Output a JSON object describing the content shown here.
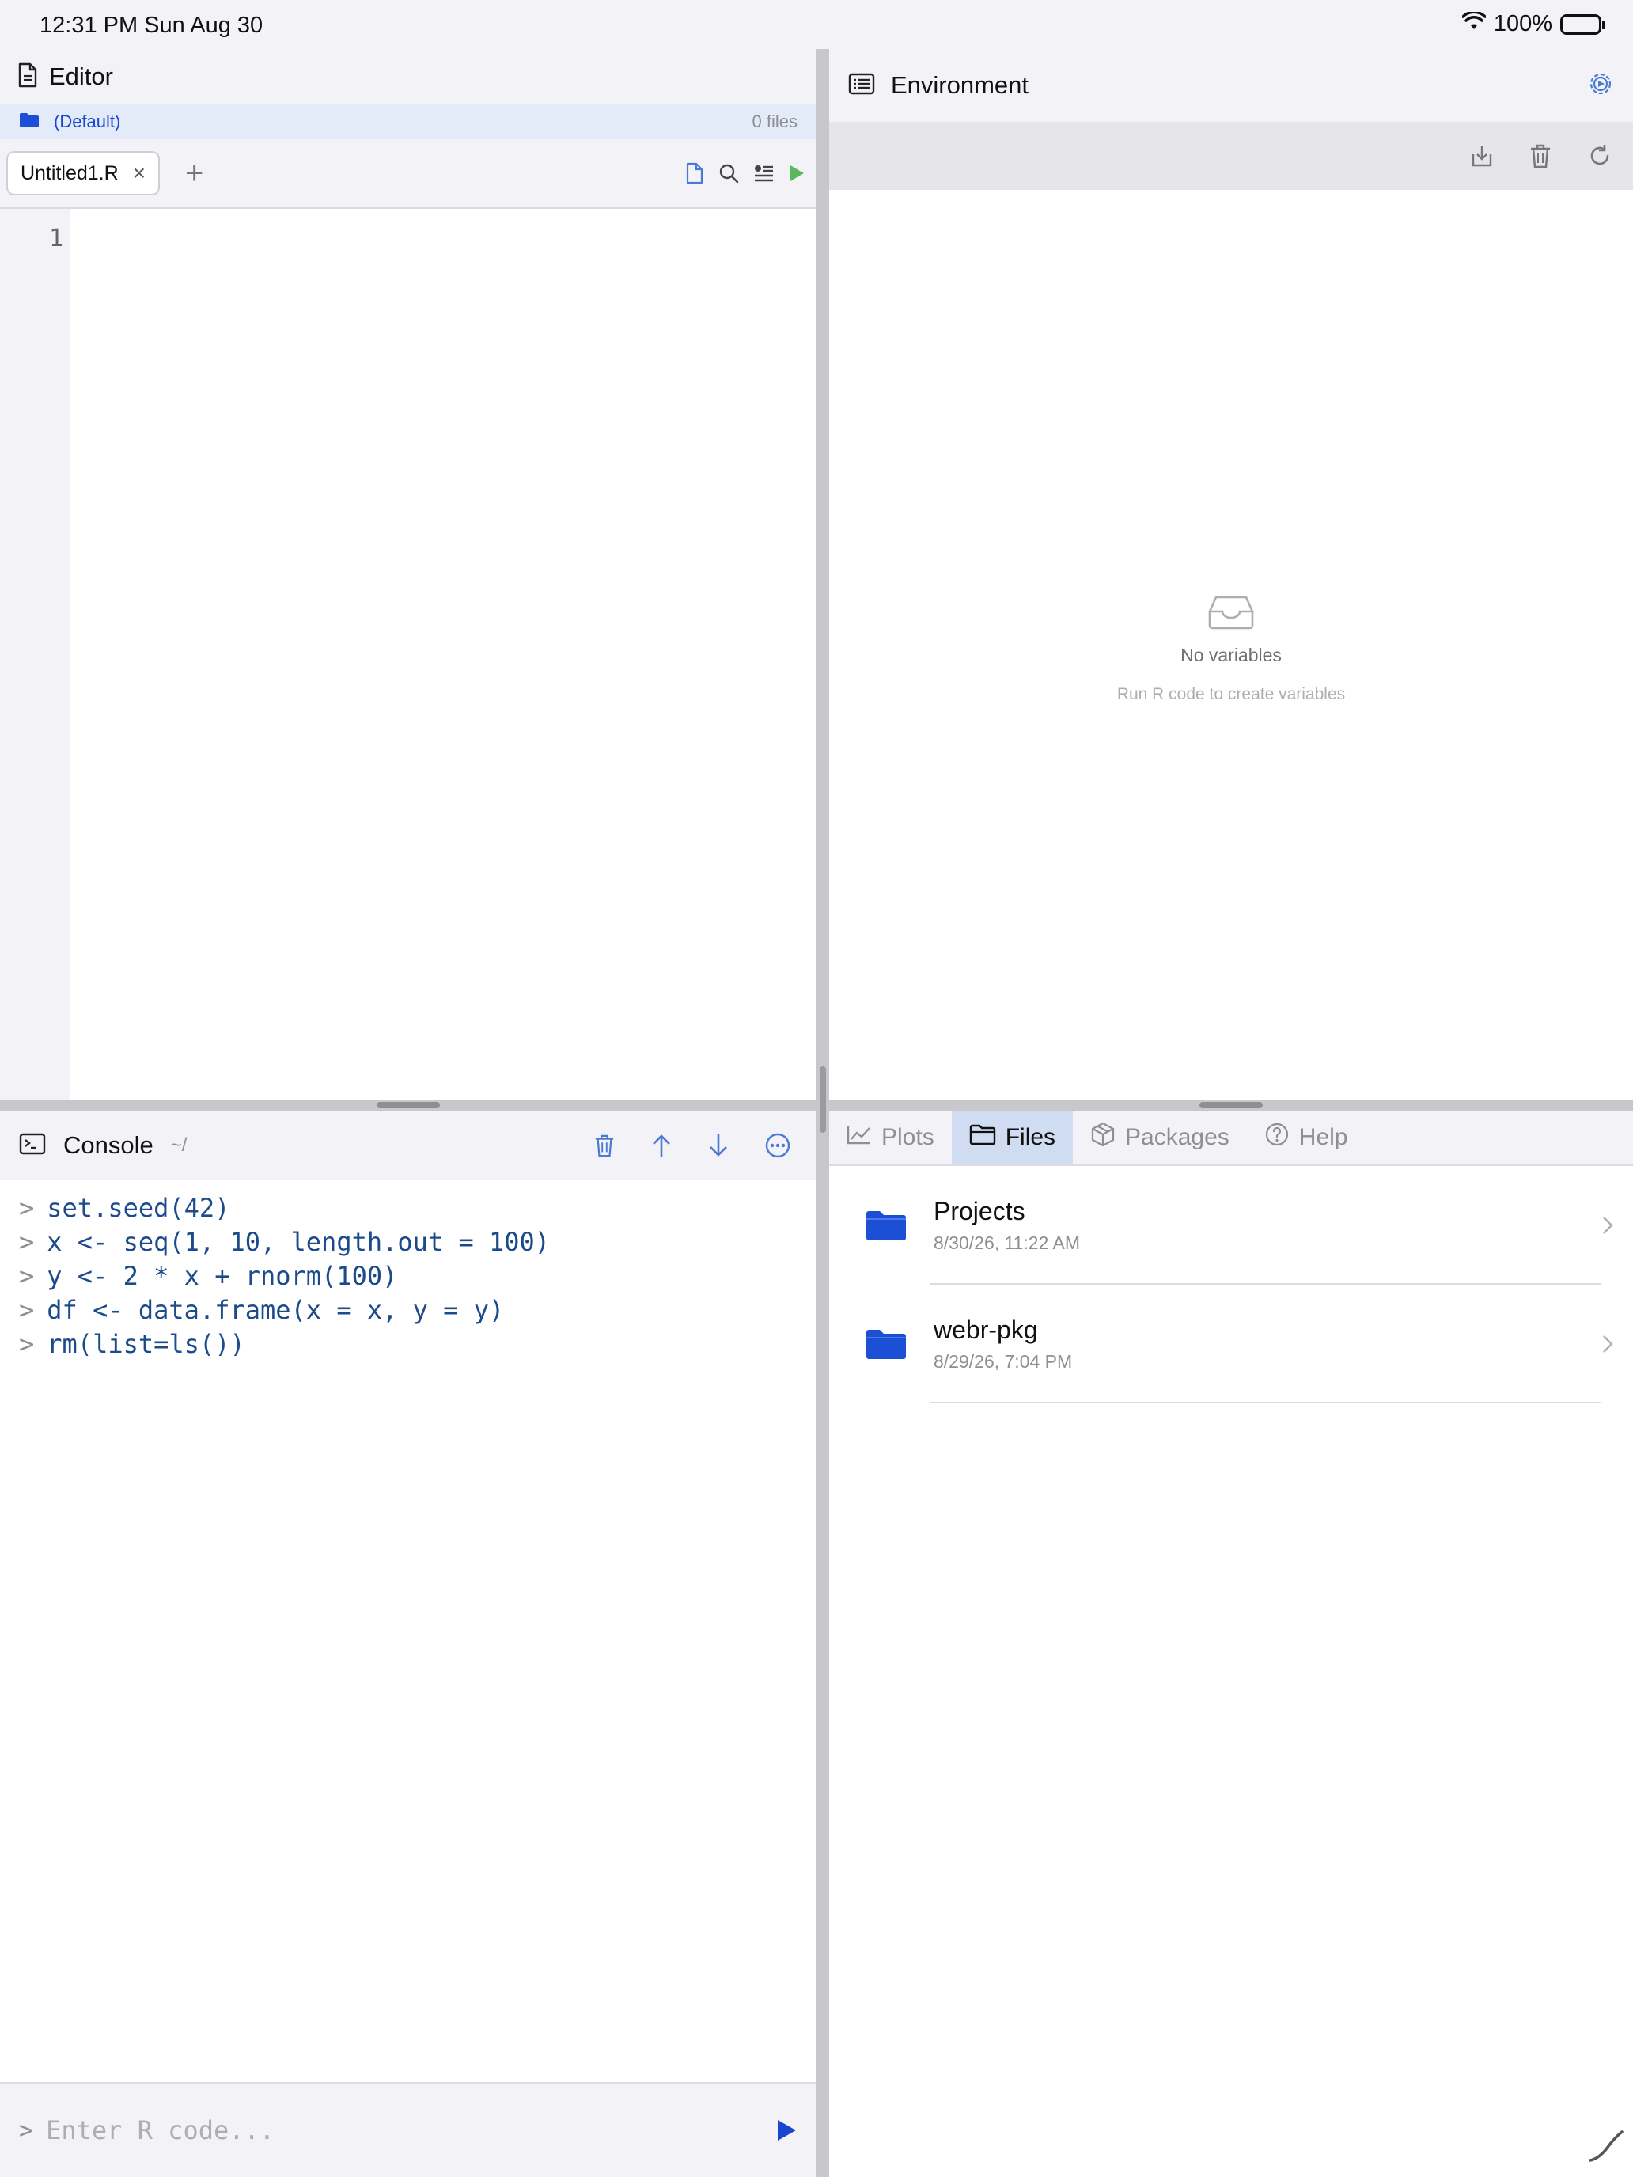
{
  "status_bar": {
    "time": "12:31 PM   Sun Aug 30",
    "battery_percent": "100%"
  },
  "editor": {
    "title": "Editor",
    "project": {
      "name": "(Default)",
      "file_count": "0 files"
    },
    "tabs": [
      {
        "label": "Untitled1.R",
        "active": true
      }
    ],
    "add_tab_label": "+",
    "close_tab_label": "×",
    "line_numbers": [
      "1"
    ]
  },
  "environment": {
    "title": "Environment",
    "empty_title": "No variables",
    "empty_subtitle": "Run R code to create variables"
  },
  "console": {
    "title": "Console",
    "path": "~/",
    "prompt": ">",
    "lines": [
      "set.seed(42)",
      "x <- seq(1, 10, length.out = 100)",
      "y <- 2 * x + rnorm(100)",
      "df <- data.frame(x = x, y = y)",
      "rm(list=ls())"
    ],
    "input_placeholder": "Enter R code..."
  },
  "files_pane": {
    "tabs": [
      {
        "label": "Plots",
        "active": false
      },
      {
        "label": "Files",
        "active": true
      },
      {
        "label": "Packages",
        "active": false
      },
      {
        "label": "Help",
        "active": false
      }
    ],
    "items": [
      {
        "name": "Projects",
        "date": "8/30/26, 11:22 AM"
      },
      {
        "name": "webr-pkg",
        "date": "8/29/26, 7:04 PM"
      }
    ]
  },
  "colors": {
    "accent": "#1747d0",
    "run_green": "#5cb85c",
    "code_text": "#1c4b8c",
    "folder_blue": "#1a4fd6"
  }
}
